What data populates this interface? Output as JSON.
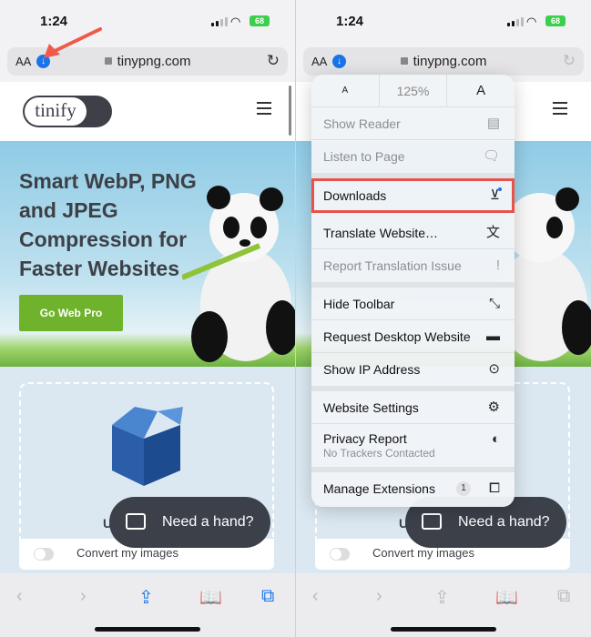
{
  "status": {
    "time": "1:24",
    "battery": "68"
  },
  "address_bar": {
    "aa": "AA",
    "url": "tinypng.com"
  },
  "site": {
    "logo": "tinify",
    "headline": "Smart WebP, PNG and JPEG Compression for Faster Websites",
    "cta": "Go Web Pro",
    "upload": "Uplo",
    "convert": "Convert my images",
    "chat": "Need a hand?"
  },
  "menu": {
    "font_small": "A",
    "zoom": "125%",
    "font_large": "A",
    "items": [
      {
        "label": "Show Reader",
        "icon": "reader-icon",
        "enabled": false
      },
      {
        "label": "Listen to Page",
        "icon": "speaker-bubble-icon",
        "enabled": false
      },
      {
        "label": "Downloads",
        "icon": "download-circle-icon",
        "enabled": true,
        "highlighted": true
      },
      {
        "label": "Translate Website…",
        "icon": "translate-icon",
        "enabled": true
      },
      {
        "label": "Report Translation Issue",
        "icon": "exclamation-bubble-icon",
        "enabled": false
      },
      {
        "label": "Hide Toolbar",
        "icon": "resize-arrows-icon",
        "enabled": true
      },
      {
        "label": "Request Desktop Website",
        "icon": "desktop-icon",
        "enabled": true
      },
      {
        "label": "Show IP Address",
        "icon": "location-pin-icon",
        "enabled": true
      },
      {
        "label": "Website Settings",
        "icon": "gear-icon",
        "enabled": true
      },
      {
        "label": "Privacy Report",
        "sub": "No Trackers Contacted",
        "icon": "shield-icon",
        "enabled": true
      },
      {
        "label": "Manage Extensions",
        "badge": "1",
        "icon": "extension-icon",
        "enabled": true
      }
    ]
  },
  "colors": {
    "accent": "#1a73e8",
    "highlight": "#e8524a",
    "cta": "#6fb32c",
    "annotation_arrow": "#ef5a4a"
  }
}
